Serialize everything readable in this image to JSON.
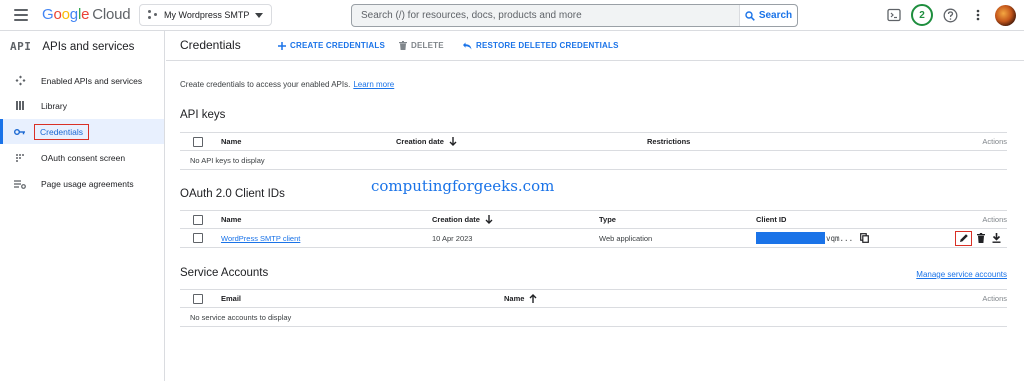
{
  "topbar": {
    "logo_google": [
      "G",
      "o",
      "o",
      "g",
      "l",
      "e"
    ],
    "logo_cloud": "Cloud",
    "project_name": "My Wordpress SMTP",
    "search_placeholder": "Search (/) for resources, docs, products and more",
    "search_button": "Search",
    "notification_count": "2",
    "icons": [
      "menu-icon",
      "project-icon",
      "terminal-icon",
      "help-icon",
      "more-vert-icon"
    ]
  },
  "sidebar": {
    "mark": "API",
    "title": "APIs and services",
    "items": [
      {
        "label": "Enabled APIs and services",
        "icon": "apis-icon",
        "active": false
      },
      {
        "label": "Library",
        "icon": "library-icon",
        "active": false
      },
      {
        "label": "Credentials",
        "icon": "key-icon",
        "active": true
      },
      {
        "label": "OAuth consent screen",
        "icon": "consent-icon",
        "active": false
      },
      {
        "label": "Page usage agreements",
        "icon": "settings-list-icon",
        "active": false
      }
    ]
  },
  "header": {
    "title": "Credentials",
    "create_label": "CREATE CREDENTIALS",
    "delete_label": "DELETE",
    "restore_label": "RESTORE DELETED CREDENTIALS"
  },
  "intro": {
    "text": "Create credentials to access your enabled APIs.",
    "link": "Learn more"
  },
  "watermark": "computingforgeeks.com",
  "api_keys": {
    "title": "API keys",
    "columns": [
      "Name",
      "Creation date",
      "Restrictions",
      "Actions"
    ],
    "empty": "No API keys to display"
  },
  "oauth": {
    "title": "OAuth 2.0 Client IDs",
    "columns": [
      "Name",
      "Creation date",
      "Type",
      "Client ID",
      "Actions"
    ],
    "rows": [
      {
        "name": "WordPress SMTP client",
        "date": "10 Apr 2023",
        "type": "Web application",
        "client_id_tail": "vqm..."
      }
    ]
  },
  "service_accounts": {
    "title": "Service Accounts",
    "manage_link": "Manage service accounts",
    "columns": [
      "Email",
      "Name",
      "Actions"
    ],
    "empty": "No service accounts to display"
  },
  "colors": {
    "accent": "#1a73e8",
    "active_bg": "#e8f0fe",
    "highlight": "#d93025",
    "status_green": "#1e8e3e"
  }
}
